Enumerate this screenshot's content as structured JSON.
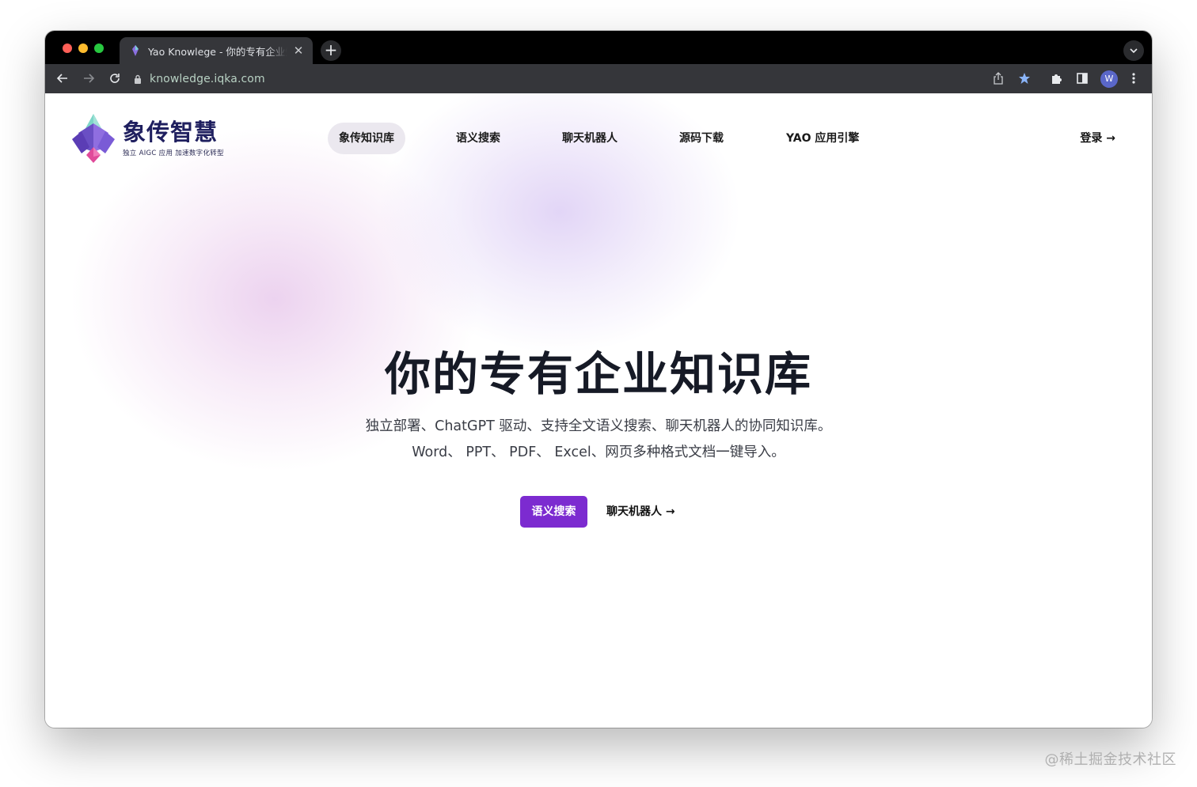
{
  "browser": {
    "tab": {
      "title": "Yao Knowlege - 你的专有企业知识库",
      "close": "✕"
    },
    "new_tab": "+",
    "url": "knowledge.iqka.com",
    "avatar_letter": "W"
  },
  "site": {
    "logo": {
      "name": "象传智慧",
      "slogan": "独立 AIGC 应用 加速数字化转型"
    },
    "nav": [
      "象传知识库",
      "语义搜索",
      "聊天机器人",
      "源码下载",
      "YAO 应用引擎"
    ],
    "login": "登录 →"
  },
  "hero": {
    "title": "你的专有企业知识库",
    "subtitle_line1": "独立部署、ChatGPT 驱动、支持全文语义搜索、聊天机器人的协同知识库。",
    "subtitle_line2": "Word、 PPT、 PDF、 Excel、网页多种格式文档一键导入。",
    "primary_button": "语义搜索",
    "secondary_link": "聊天机器人 →"
  },
  "watermark": "@稀土掘金技术社区",
  "colors": {
    "brand": "#7c2bd0",
    "tabbar": "#000000",
    "toolbar": "#35363a"
  }
}
